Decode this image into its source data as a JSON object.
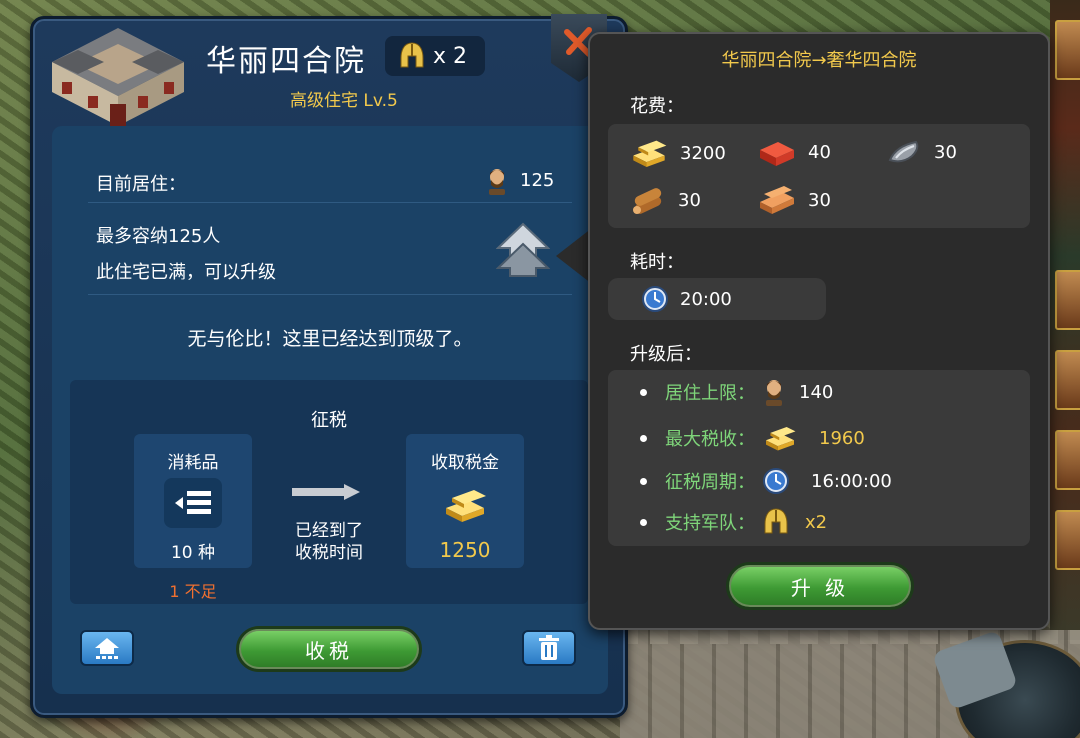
{
  "building": {
    "name": "华丽四合院",
    "troop_badge": "x 2",
    "subtitle": "高级住宅 Lv.5"
  },
  "residence": {
    "current_label": "目前居住：",
    "current_value": "125",
    "capacity_text": "最多容纳125人",
    "status_text": "此住宅已满，可以升级",
    "max_level_msg": "无与伦比！这里已经达到顶级了。"
  },
  "tax": {
    "title": "征税",
    "consumables_label": "消耗品",
    "consumables_count": "10 种",
    "shortage": "1 不足",
    "arrow_text_1": "已经到了",
    "arrow_text_2": "收税时间",
    "collect_label": "收取税金",
    "collect_value": "1250",
    "collect_button": "收税"
  },
  "upgrade": {
    "title": "华丽四合院→奢华四合院",
    "cost_label": "花费：",
    "costs": [
      {
        "icon": "gold-icon",
        "value": "3200"
      },
      {
        "icon": "brick-icon",
        "value": "40"
      },
      {
        "icon": "iron-icon",
        "value": "30"
      },
      {
        "icon": "wood-icon",
        "value": "30"
      },
      {
        "icon": "plank-icon",
        "value": "30"
      }
    ],
    "time_label": "耗时：",
    "time_value": "20:00",
    "after_label": "升级后：",
    "after": [
      {
        "key": "居住上限：",
        "icon": "resident-icon",
        "value": "140"
      },
      {
        "key": "最大税收：",
        "icon": "gold-icon",
        "value": "1960"
      },
      {
        "key": "征税周期：",
        "icon": "clock-icon",
        "value": "16:00:00"
      },
      {
        "key": "支持军队：",
        "icon": "helmet-icon",
        "value": "x2"
      }
    ],
    "button": "升 级"
  },
  "colors": {
    "panel": "#1e3a5c",
    "gold_text": "#f2c94c",
    "green_text": "#7fd67a",
    "warning": "#f07030"
  }
}
